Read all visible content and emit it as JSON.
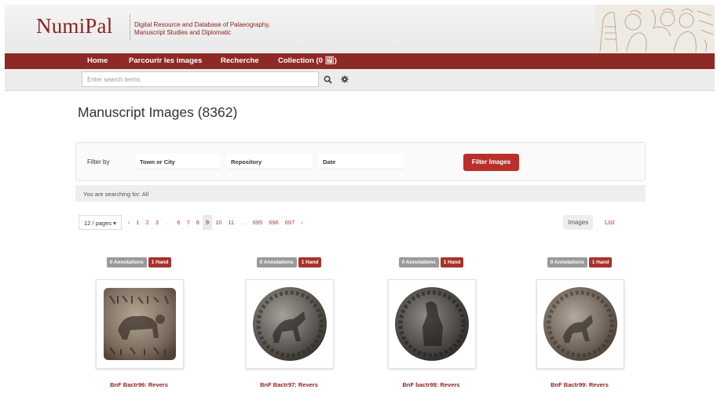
{
  "header": {
    "logo": "NumiPal",
    "tagline_line1": "Digital Resource and Database of Palaeography,",
    "tagline_line2": "Manuscript Studies and Diplomatic"
  },
  "nav": {
    "items": [
      "Home",
      "Parcourir les images",
      "Recherche",
      "Collection (0 🖼)"
    ]
  },
  "search": {
    "placeholder": "Enter search terms",
    "search_icon": "search-icon",
    "settings_icon": "gear-icon"
  },
  "page_title": "Manuscript Images (8362)",
  "filter": {
    "label": "Filter by",
    "fields": [
      "Town or City",
      "Repository",
      "Date"
    ],
    "button": "Filter Images"
  },
  "search_status": "You are searching for: All",
  "pagination": {
    "per_page": "12 / pages ▾",
    "prev": "‹",
    "pages": [
      "1",
      "2",
      "3",
      "…",
      "6",
      "7",
      "8",
      "9",
      "10",
      "11",
      "…",
      "695",
      "696",
      "697"
    ],
    "active_page": "9",
    "next": "›"
  },
  "view": {
    "images": "Images",
    "list": "List"
  },
  "cards": [
    {
      "annotations": "0 Annotations",
      "hand": "1 Hand",
      "caption": "BnF Bactr96: Revers"
    },
    {
      "annotations": "0 Annotations",
      "hand": "1 Hand",
      "caption": "BnF Bactr97: Revers"
    },
    {
      "annotations": "0 Annotations",
      "hand": "1 Hand",
      "caption": "BnF bactr98: Revers"
    },
    {
      "annotations": "0 Annotations",
      "hand": "1 Hand",
      "caption": "BnF Bactr99: Revers"
    }
  ],
  "colors": {
    "brand": "#8d2a25",
    "button": "#b8302c",
    "link": "#a4403b"
  }
}
